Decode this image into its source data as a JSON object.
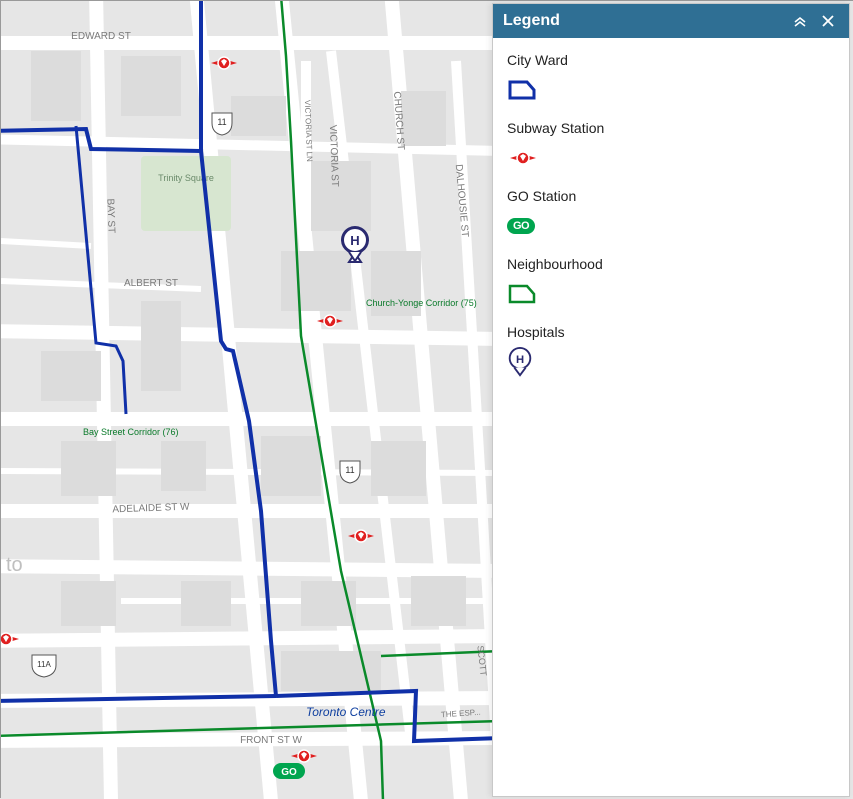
{
  "legend": {
    "title": "Legend",
    "items": [
      {
        "label": "City Ward",
        "symbol": "ward-outline"
      },
      {
        "label": "Subway Station",
        "symbol": "ttc"
      },
      {
        "label": "GO Station",
        "symbol": "go"
      },
      {
        "label": "Neighbourhood",
        "symbol": "neighbourhood-outline"
      },
      {
        "label": "Hospitals",
        "symbol": "hospital"
      }
    ]
  },
  "map": {
    "streets": {
      "edward_st": "EDWARD ST",
      "albert_st": "ALBERT ST",
      "adelaide_st_w": "ADELAIDE ST W",
      "front_st_w": "FRONT ST W",
      "victoria_st": "VICTORIA ST",
      "victoria_st_ln": "VICTORIA ST LN",
      "church_st": "CHURCH ST",
      "dalhousie_st": "DALHOUSIE ST",
      "bay_st": "BAY ST",
      "scott": "SCOTT",
      "the_espl": "THE ESP..."
    },
    "neighbourhoods": {
      "bay_street_corridor": "Bay Street Corridor (76)",
      "church_yonge_corridor": "Church-Yonge Corridor (75)"
    },
    "places": {
      "trinity_square": "Trinity Square",
      "toronto_centre": "Toronto Centre",
      "to_suffix": "to"
    },
    "hwy": {
      "eleven": "11",
      "eleven_a": "11A"
    },
    "go_text": "GO"
  }
}
